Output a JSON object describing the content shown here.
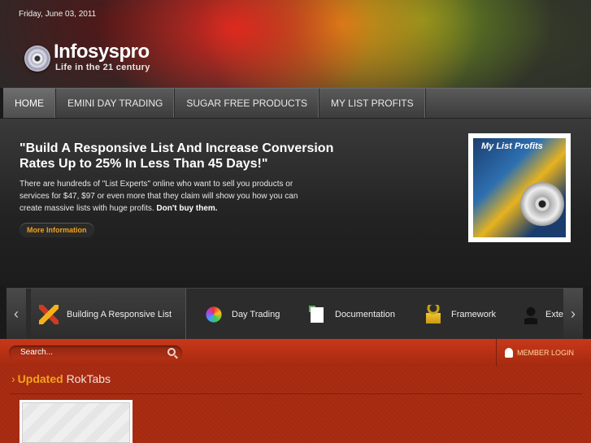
{
  "header": {
    "date": "Friday, June 03, 2011",
    "logo": {
      "name": "Infosyspro",
      "tagline": "Life in the 21 century",
      "icon": "disc-icon"
    }
  },
  "nav": {
    "items": [
      {
        "label": "HOME",
        "active": true
      },
      {
        "label": "EMINI DAY TRADING",
        "active": false
      },
      {
        "label": "SUGAR FREE PRODUCTS",
        "active": false
      },
      {
        "label": "MY LIST PROFITS",
        "active": false
      }
    ]
  },
  "hero": {
    "title": "\"Build A Responsive List And Increase Conversion Rates Up to 25% In Less Than 45 Days!\"",
    "body": "There are hundreds of \"List Experts\" online who want to sell you products or services for $47, $97 or even more that they claim will show you how you can create massive lists with huge profits.",
    "body_strong": "Don't buy them.",
    "button": "More Information",
    "product_title": "My List Profits"
  },
  "tabs": {
    "items": [
      {
        "label": "Building A Responsive List",
        "icon": "pencil-icon",
        "active": true
      },
      {
        "label": "Day Trading",
        "icon": "color-wheel-icon",
        "active": false
      },
      {
        "label": "Documentation",
        "icon": "document-icon",
        "active": false
      },
      {
        "label": "Framework",
        "icon": "lock-icon",
        "active": false
      },
      {
        "label": "Exte",
        "icon": "person-icon",
        "active": false
      }
    ],
    "prev_icon": "chevron-left-icon",
    "next_icon": "chevron-right-icon"
  },
  "search": {
    "placeholder": "Search..."
  },
  "member": {
    "label": "MEMBER LOGIN"
  },
  "section": {
    "highlight": "Updated",
    "title": "RokTabs"
  },
  "colors": {
    "accent": "#f6a21a",
    "red_bar": "#b8311a",
    "dark": "#2c2c2c"
  }
}
